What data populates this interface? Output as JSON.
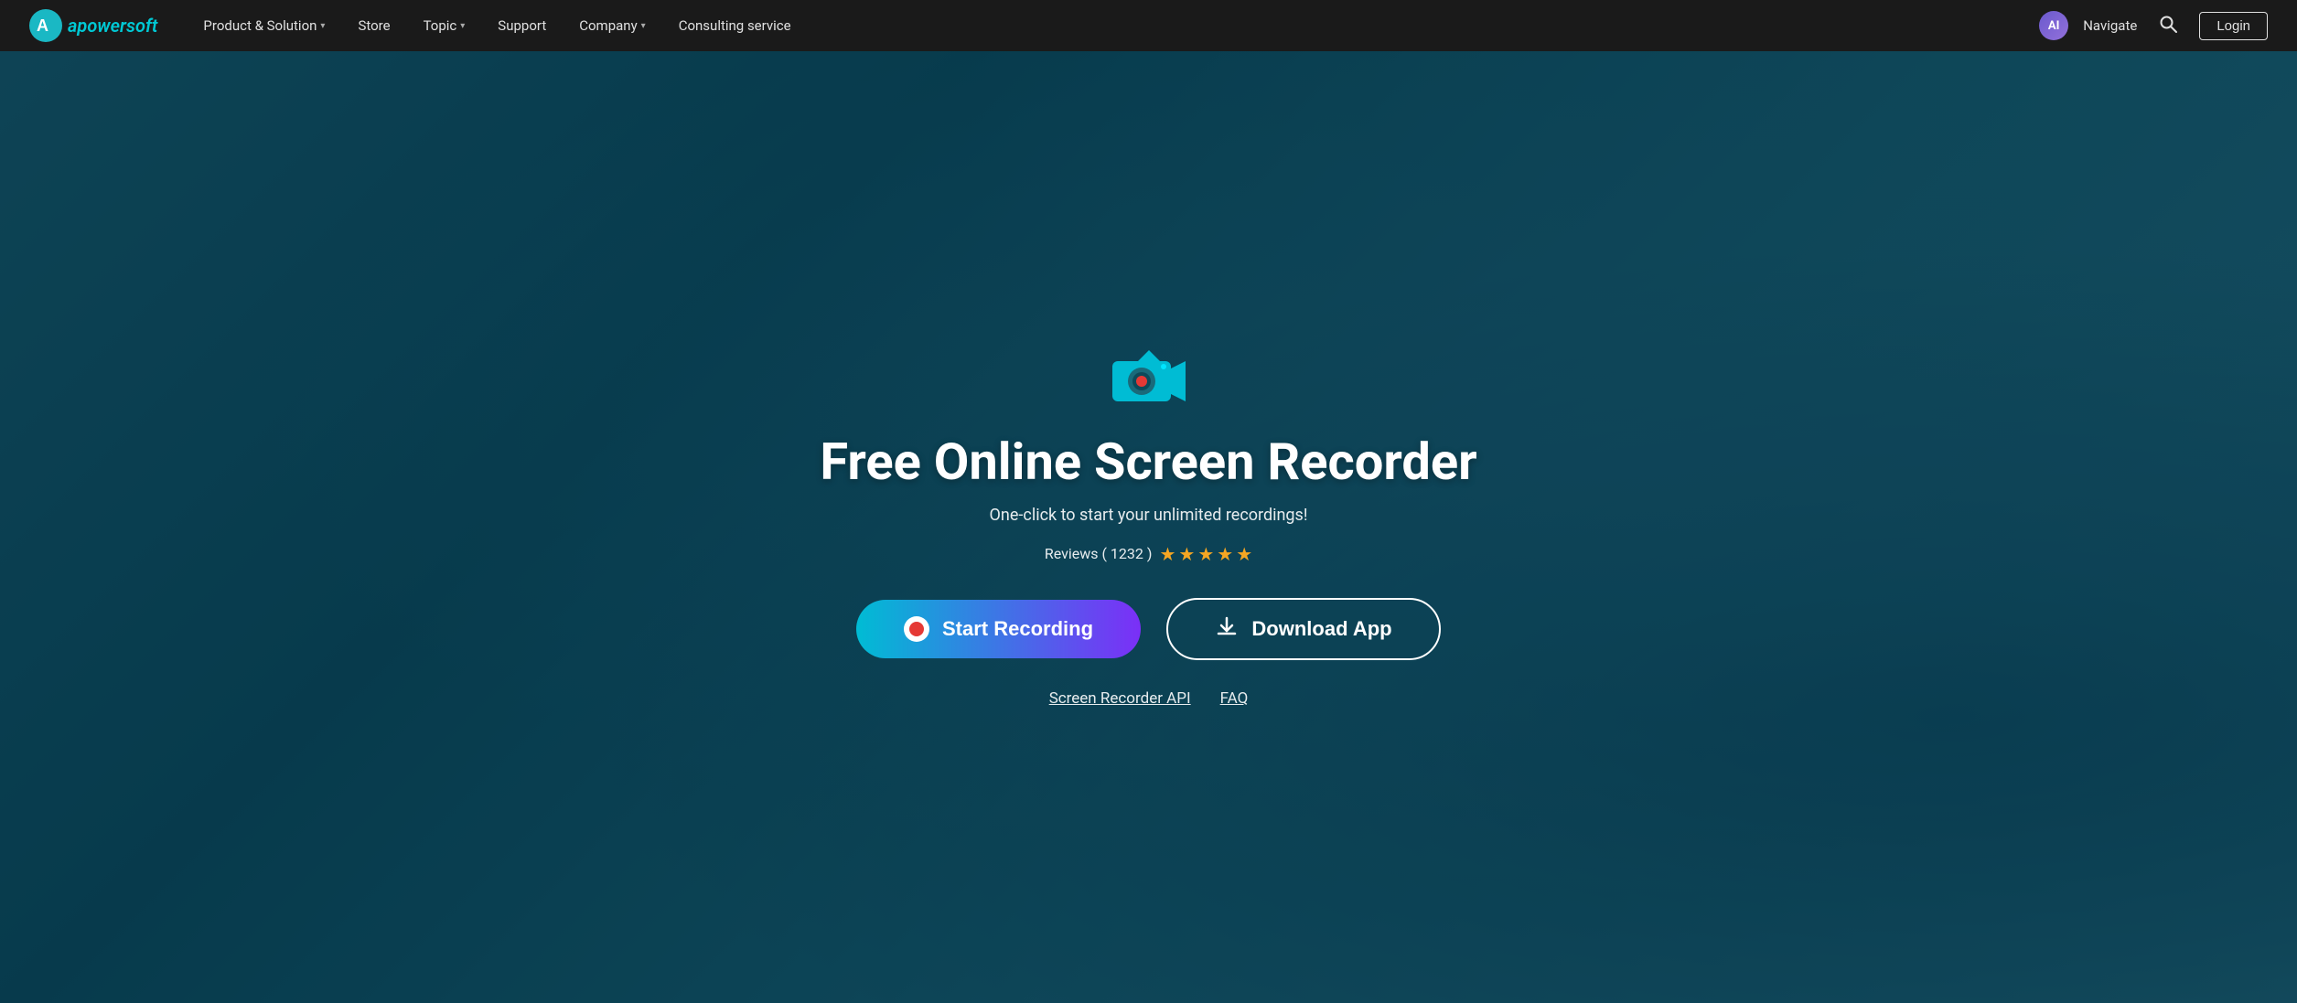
{
  "nav": {
    "logo_text": "apowersoft",
    "items": [
      {
        "label": "Product & Solution",
        "has_dropdown": true
      },
      {
        "label": "Store",
        "has_dropdown": false
      },
      {
        "label": "Topic",
        "has_dropdown": true
      },
      {
        "label": "Support",
        "has_dropdown": false
      },
      {
        "label": "Company",
        "has_dropdown": true
      },
      {
        "label": "Consulting service",
        "has_dropdown": false
      }
    ],
    "ai_avatar_text": "AI",
    "navigate_label": "Navigate",
    "search_icon": "search-icon",
    "login_label": "Login"
  },
  "hero": {
    "title": "Free Online Screen Recorder",
    "subtitle": "One-click to start your unlimited recordings!",
    "reviews_label": "Reviews ( 1232 )",
    "star_count": 5,
    "btn_start_label": "Start Recording",
    "btn_download_label": "Download App",
    "link_api": "Screen Recorder API",
    "link_faq": "FAQ"
  }
}
